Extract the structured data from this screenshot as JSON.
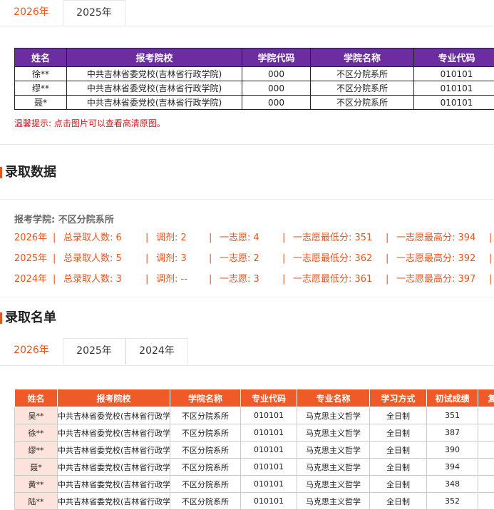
{
  "top_tabs": [
    {
      "label": "2026年",
      "active": true
    },
    {
      "label": "2025年",
      "active": false
    }
  ],
  "reexam_table": {
    "headers": [
      "姓名",
      "报考院校",
      "学院代码",
      "学院名称",
      "专业代码"
    ],
    "rows": [
      [
        "徐**",
        "中共吉林省委党校(吉林省行政学院)",
        "000",
        "不区分院系所",
        "010101"
      ],
      [
        "缪**",
        "中共吉林省委党校(吉林省行政学院)",
        "000",
        "不区分院系所",
        "010101"
      ],
      [
        "聂*",
        "中共吉林省委党校(吉林省行政学院)",
        "000",
        "不区分院系所",
        "010101"
      ]
    ]
  },
  "hint": "温馨提示: 点击图片可以查看高清原图。",
  "admission_data": {
    "title": "录取数据",
    "college_label": "报考学院: 不区分院系所",
    "rows": [
      {
        "year": "2026年",
        "total": "总录取人数: 6",
        "adjust": "调剂: 2",
        "first": "一志愿: 4",
        "min": "一志愿最低分: 351",
        "max": "一志愿最高分: 394"
      },
      {
        "year": "2025年",
        "total": "总录取人数: 5",
        "adjust": "调剂: 3",
        "first": "一志愿: 2",
        "min": "一志愿最低分: 362",
        "max": "一志愿最高分: 392"
      },
      {
        "year": "2024年",
        "total": "总录取人数: 3",
        "adjust": "调剂: --",
        "first": "一志愿: 3",
        "min": "一志愿最低分: 361",
        "max": "一志愿最高分: 397"
      }
    ],
    "separator": "|"
  },
  "admission_list": {
    "title": "录取名单",
    "tabs": [
      {
        "label": "2026年",
        "active": true
      },
      {
        "label": "2025年",
        "active": false
      },
      {
        "label": "2024年",
        "active": false
      }
    ],
    "headers": [
      "姓名",
      "报考院校",
      "学院名称",
      "专业代码",
      "专业名称",
      "学习方式",
      "初试成绩",
      "复"
    ],
    "rows": [
      [
        "吴**",
        "中共吉林省委党校(吉林省行政学院)",
        "不区分院系所",
        "010101",
        "马克思主义哲学",
        "全日制",
        "351",
        ""
      ],
      [
        "徐**",
        "中共吉林省委党校(吉林省行政学院)",
        "不区分院系所",
        "010101",
        "马克思主义哲学",
        "全日制",
        "387",
        ""
      ],
      [
        "缪**",
        "中共吉林省委党校(吉林省行政学院)",
        "不区分院系所",
        "010101",
        "马克思主义哲学",
        "全日制",
        "390",
        ""
      ],
      [
        "聂*",
        "中共吉林省委党校(吉林省行政学院)",
        "不区分院系所",
        "010101",
        "马克思主义哲学",
        "全日制",
        "394",
        ""
      ],
      [
        "黄**",
        "中共吉林省委党校(吉林省行政学院)",
        "不区分院系所",
        "010101",
        "马克思主义哲学",
        "全日制",
        "348",
        ""
      ],
      [
        "陆**",
        "中共吉林省委党校(吉林省行政学院)",
        "不区分院系所",
        "010101",
        "马克思主义哲学",
        "全日制",
        "352",
        ""
      ]
    ]
  },
  "colors": {
    "accent": "#e8541e",
    "purple_header": "#6b2da0",
    "orange_header": "#f05a28",
    "hint_red": "#d6141c"
  }
}
